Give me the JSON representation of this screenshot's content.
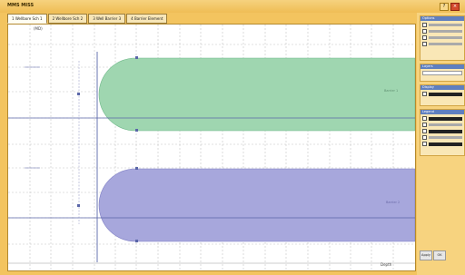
{
  "window": {
    "title": "MMS MISS",
    "buttons": {
      "help": "?",
      "close": "×"
    }
  },
  "tabs": [
    {
      "label": "1 Wellbore Sch 1",
      "active": true
    },
    {
      "label": "2 Wellbore Sch 2",
      "active": false
    },
    {
      "label": "3 Well Barrier 3",
      "active": false
    },
    {
      "label": "4 Barrier Element",
      "active": false
    }
  ],
  "plot": {
    "corner_label": "(MD)",
    "x_axis_label": "Depth",
    "colors": {
      "green_fill": "#9fd6b0",
      "blue_fill": "#a7a7dc",
      "grid": "#c4c4c4",
      "axis_line": "#5a66a8"
    },
    "bands": [
      {
        "name": "green",
        "center_label": "Barrier 1"
      },
      {
        "name": "blue",
        "center_label": "Barrier 2"
      }
    ]
  },
  "sidebar": {
    "panels": [
      {
        "header": "Options"
      },
      {
        "header": "Layers"
      },
      {
        "header": "Display"
      },
      {
        "header": "Legend"
      }
    ],
    "footer": {
      "apply": "Apply",
      "ok": "OK"
    }
  }
}
